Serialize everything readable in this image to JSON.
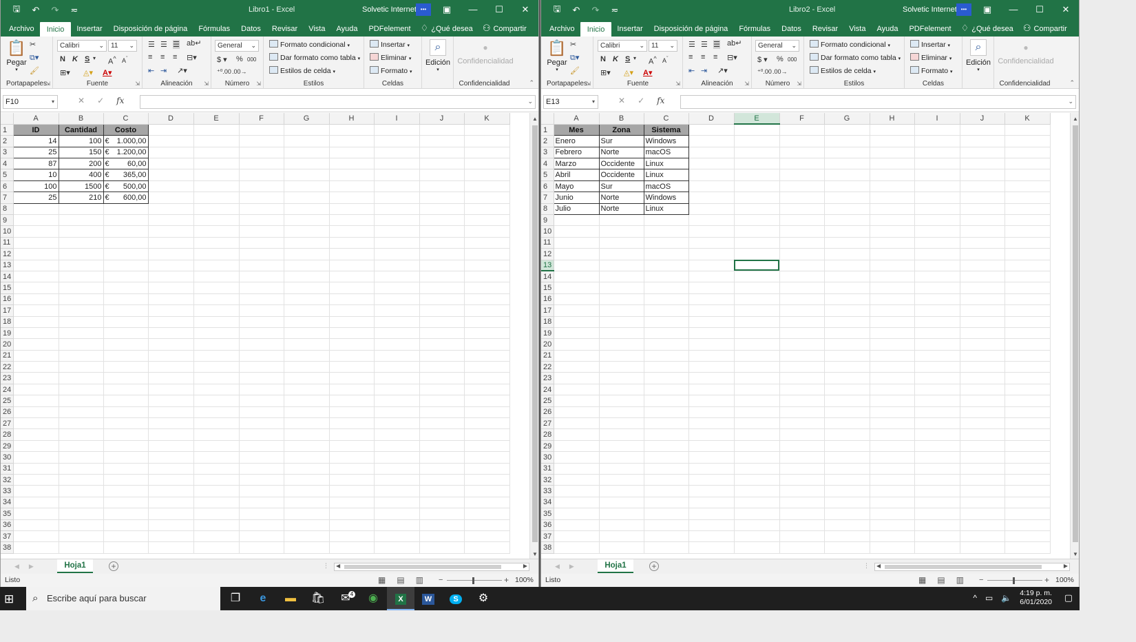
{
  "windows": [
    {
      "title": "Libro1  -  Excel",
      "user": "Solvetic Internet",
      "ribbon_tabs": [
        "Archivo",
        "Inicio",
        "Insertar",
        "Disposición de página",
        "Fórmulas",
        "Datos",
        "Revisar",
        "Vista",
        "Ayuda",
        "PDFelement"
      ],
      "tell_me": "¿Qué desea",
      "share": "Compartir",
      "name_box": "F10",
      "selected_col": "",
      "selected_row": "",
      "col_headers": [
        "A",
        "B",
        "C",
        "D",
        "E",
        "F",
        "G",
        "H",
        "I",
        "J",
        "K"
      ],
      "header_row": [
        "ID",
        "Cantidad",
        "Costo"
      ],
      "data_rows": [
        [
          "14",
          "100",
          "1.000,00"
        ],
        [
          "25",
          "150",
          "1.200,00"
        ],
        [
          "87",
          "200",
          "60,00"
        ],
        [
          "10",
          "400",
          "365,00"
        ],
        [
          "100",
          "1500",
          "500,00"
        ],
        [
          "25",
          "210",
          "600,00"
        ]
      ],
      "currency_symbol": "€",
      "sheet_tab": "Hoja1",
      "status": "Listo",
      "zoom": "100%"
    },
    {
      "title": "Libro2  -  Excel",
      "user": "Solvetic Internet",
      "ribbon_tabs": [
        "Archivo",
        "Inicio",
        "Insertar",
        "Disposición de página",
        "Fórmulas",
        "Datos",
        "Revisar",
        "Vista",
        "Ayuda",
        "PDFelement"
      ],
      "tell_me": "¿Qué desea",
      "share": "Compartir",
      "name_box": "E13",
      "selected_col": "E",
      "selected_row": "13",
      "col_headers": [
        "A",
        "B",
        "C",
        "D",
        "E",
        "F",
        "G",
        "H",
        "I",
        "J",
        "K"
      ],
      "header_row": [
        "Mes",
        "Zona",
        "Sistema"
      ],
      "data_rows": [
        [
          "Enero",
          "Sur",
          "Windows"
        ],
        [
          "Febrero",
          "Norte",
          "macOS"
        ],
        [
          "Marzo",
          "Occidente",
          "Linux"
        ],
        [
          "Abril",
          "Occidente",
          "Linux"
        ],
        [
          "Mayo",
          "Sur",
          "macOS"
        ],
        [
          "Junio",
          "Norte",
          "Windows"
        ],
        [
          "Julio",
          "Norte",
          "Linux"
        ]
      ],
      "sheet_tab": "Hoja1",
      "status": "Listo",
      "zoom": "100%"
    }
  ],
  "ribbon": {
    "paste_label": "Pegar",
    "font_name": "Calibri",
    "font_size": "11",
    "number_format": "General",
    "conditional_format": "Formato condicional",
    "format_as_table": "Dar formato como tabla",
    "cell_styles": "Estilos de celda",
    "insert": "Insertar",
    "delete": "Eliminar",
    "format": "Formato",
    "editing": "Edición",
    "confidentiality": "Confidencialidad",
    "groups": [
      "Portapapeles",
      "Fuente",
      "Alineación",
      "Número",
      "Estilos",
      "Celdas",
      "Confidencialidad"
    ],
    "bold": "N",
    "italic": "K",
    "underline": "S"
  },
  "taskbar": {
    "search_placeholder": "Escribe aquí para buscar",
    "time": "4:19 p. m.",
    "date": "6/01/2020",
    "mail_badge": "4"
  },
  "colors": {
    "excel_green": "#217346",
    "table_header_fill": "#a6a6a6"
  }
}
